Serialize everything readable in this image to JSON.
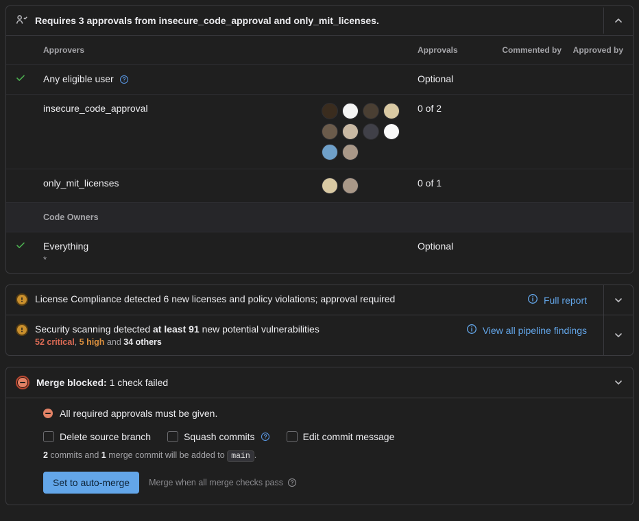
{
  "approvals_panel": {
    "title": "Requires 3 approvals from insecure_code_approval and only_mit_licenses.",
    "columns": {
      "approvers": "Approvers",
      "approvals": "Approvals",
      "commented_by": "Commented by",
      "approved_by": "Approved by"
    },
    "rows": [
      {
        "status": "ok",
        "name": "Any eligible user",
        "has_help": true,
        "avatars": 0,
        "approvals": "Optional"
      },
      {
        "status": "",
        "name": "insecure_code_approval",
        "avatars": 10,
        "approvals": "0 of 2"
      },
      {
        "status": "",
        "name": "only_mit_licenses",
        "avatars": 2,
        "approvals": "0 of 1"
      }
    ],
    "code_owners_label": "Code Owners",
    "code_owners_row": {
      "status": "ok",
      "name": "Everything",
      "pattern": "*",
      "approvals": "Optional"
    }
  },
  "compliance_panel": {
    "license_text": "License Compliance detected 6 new licenses and policy violations; approval required",
    "license_link": "Full report",
    "security_prefix": "Security scanning detected ",
    "security_bold": "at least 91",
    "security_suffix": " new potential vulnerabilities",
    "security_sub_critical": "52 critical",
    "security_sub_high": "5 high",
    "security_sub_sep": ", ",
    "security_sub_and": " and ",
    "security_sub_others": "34 others",
    "security_link": "View all pipeline findings"
  },
  "merge_panel": {
    "title_strong": "Merge blocked:",
    "title_rest": " 1 check failed",
    "reason": "All required approvals must be given.",
    "checkboxes": {
      "delete_branch": "Delete source branch",
      "squash": "Squash commits",
      "edit_msg": "Edit commit message"
    },
    "commit_note_1": "2",
    "commit_note_2": " commits and ",
    "commit_note_3": "1",
    "commit_note_4": " merge commit will be added to ",
    "commit_note_branch": "main",
    "commit_note_5": ".",
    "button": "Set to auto-merge",
    "hint": "Merge when all merge checks pass"
  }
}
